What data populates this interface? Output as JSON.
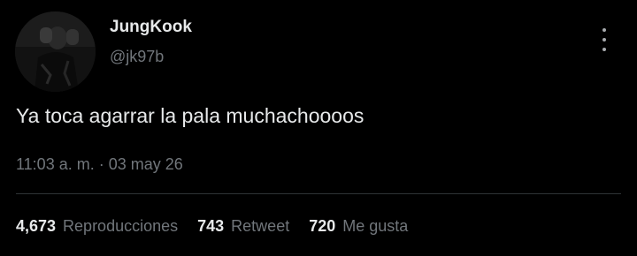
{
  "author": {
    "name": "JungKook",
    "handle": "@jk97b"
  },
  "tweet": {
    "text": "Ya toca agarrar la pala muchachoooos",
    "time": "11:03 a. m.",
    "separator": "·",
    "date": "03 may 26"
  },
  "stats": [
    {
      "value": "4,673",
      "label": "Reproducciones"
    },
    {
      "value": "743",
      "label": "Retweet"
    },
    {
      "value": "720",
      "label": "Me gusta"
    }
  ],
  "icons": {
    "more": "more-vertical-icon"
  },
  "colors": {
    "background": "#000000",
    "text_primary": "#e7e9ea",
    "text_secondary": "#71767b",
    "divider": "#2f3336"
  }
}
